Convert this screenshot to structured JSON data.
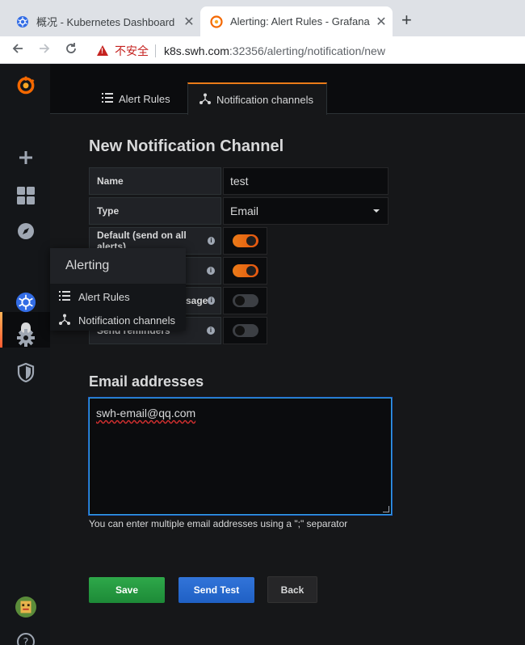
{
  "browser": {
    "tabs": [
      {
        "title": "概况 - Kubernetes Dashboard",
        "active": false,
        "favicon": "kubernetes-icon"
      },
      {
        "title": "Alerting: Alert Rules - Grafana",
        "active": true,
        "favicon": "grafana-icon"
      }
    ],
    "new_tab_label": "+",
    "close_label": "✕",
    "security_label": "不安全",
    "url_host": "k8s.swh.com",
    "url_path": ":32356/alerting/notification/new"
  },
  "sidebar": {
    "icons": [
      "grafana-logo-icon",
      "plus-icon",
      "dashboards-icon",
      "explore-icon",
      "bell-icon",
      "kubernetes-icon",
      "gear-icon",
      "shield-icon",
      "user-avatar-icon",
      "help-icon"
    ],
    "help_label": "?"
  },
  "page_tabs": [
    {
      "label": "Alert Rules",
      "icon": "list-icon"
    },
    {
      "label": "Notification channels",
      "icon": "share-nodes-icon"
    }
  ],
  "form": {
    "title": "New Notification Channel",
    "name_label": "Name",
    "name_value": "test",
    "type_label": "Type",
    "type_value": "Email",
    "default_label": "Default (send on all alerts)",
    "default_on": true,
    "include_image_on": true,
    "disable_resolve_label_tail": "sage",
    "disable_resolve_on": false,
    "send_reminders_label": "Send reminders",
    "send_reminders_on": false
  },
  "email": {
    "title": "Email addresses",
    "value": "swh-email@qq.com",
    "help": "You can enter multiple email addresses using a \";\" separator"
  },
  "buttons": {
    "save": "Save",
    "send_test": "Send Test",
    "back": "Back"
  },
  "alerting_menu": {
    "header": "Alerting",
    "items": [
      {
        "label": "Alert Rules",
        "icon": "list-icon"
      },
      {
        "label": "Notification channels",
        "icon": "share-nodes-icon"
      }
    ]
  },
  "colors": {
    "accent_orange": "#eb7b18",
    "save_green": "#299c46",
    "test_blue": "#3274d9",
    "background": "#161719"
  }
}
